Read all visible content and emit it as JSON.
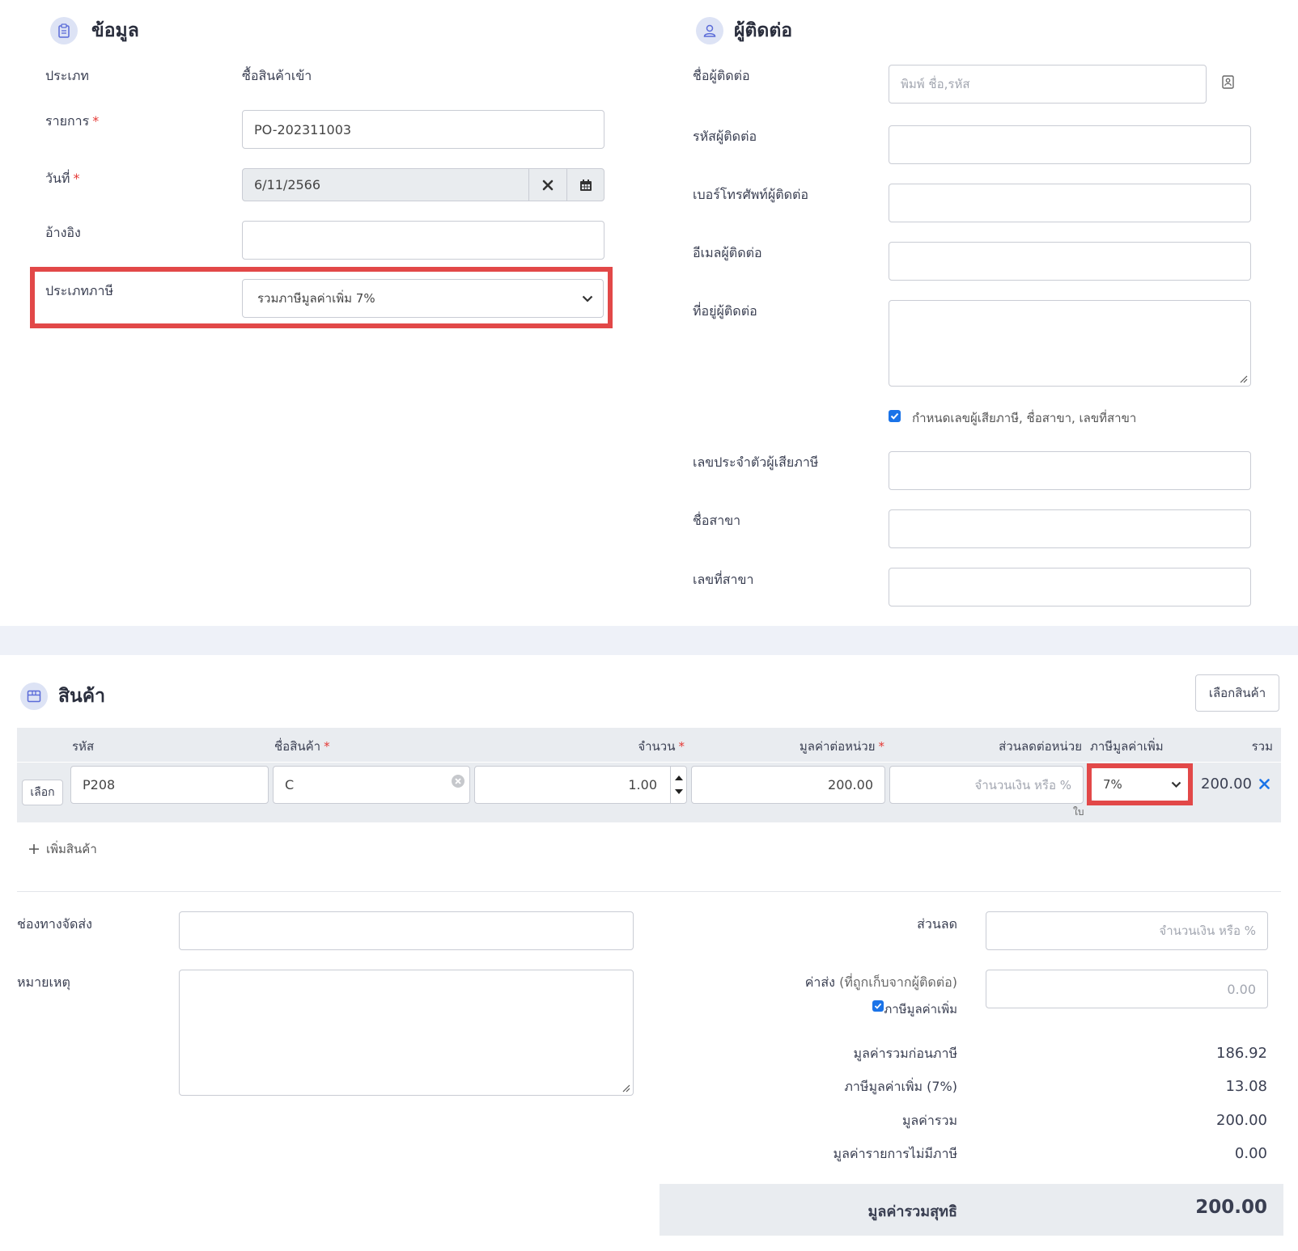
{
  "info": {
    "title": "ข้อมูล",
    "type_label": "ประเภท",
    "type_value": "ซื้อสินค้าเข้า",
    "doc_label": "รายการ",
    "doc_value": "PO-202311003",
    "date_label": "วันที่",
    "date_value": "6/11/2566",
    "ref_label": "อ้างอิง",
    "ref_value": "",
    "tax_type_label": "ประเภทภาษี",
    "tax_type_value": "รวมภาษีมูลค่าเพิ่ม 7%",
    "required_mark": "*"
  },
  "contact": {
    "title": "ผู้ติดต่อ",
    "name_label": "ชื่อผู้ติดต่อ",
    "name_placeholder": "พิมพ์ ชื่อ,รหัส",
    "code_label": "รหัสผู้ติดต่อ",
    "phone_label": "เบอร์โทรศัพท์ผู้ติดต่อ",
    "email_label": "อีเมลผู้ติดต่อ",
    "address_label": "ที่อยู่ผู้ติดต่อ",
    "taxid_checkbox_label": "กำหนดเลขผู้เสียภาษี, ชื่อสาขา, เลขที่สาขา",
    "taxid_label": "เลขประจำตัวผู้เสียภาษี",
    "branch_name_label": "ชื่อสาขา",
    "branch_no_label": "เลขที่สาขา"
  },
  "products": {
    "title": "สินค้า",
    "select_products_button": "เลือกสินค้า",
    "columns": {
      "code": "รหัส",
      "name": "ชื่อสินค้า",
      "qty": "จำนวน",
      "unit_price": "มูลค่าต่อหน่วย",
      "discount": "ส่วนลดต่อหน่วย",
      "vat": "ภาษีมูลค่าเพิ่ม",
      "total": "รวม"
    },
    "row": {
      "select_button": "เลือก",
      "code": "P208",
      "name": "C",
      "qty": "1.00",
      "unit_price": "200.00",
      "discount_placeholder": "จำนวนเงิน หรือ %",
      "unit": "ใบ",
      "vat": "7%",
      "total": "200.00"
    },
    "add_product": "เพิ่มสินค้า"
  },
  "footer": {
    "shipping_label": "ช่องทางจัดส่ง",
    "note_label": "หมายเหตุ",
    "discount_label": "ส่วนลด",
    "discount_placeholder": "จำนวนเงิน หรือ %",
    "shipping_fee_label": "ค่าส่ง",
    "shipping_fee_hint": "(ที่ถูกเก็บจากผู้ติดต่อ)",
    "shipping_fee_placeholder": "0.00",
    "shipping_vat_label": "ภาษีมูลค่าเพิ่ม",
    "pre_tax_label": "มูลค่ารวมก่อนภาษี",
    "pre_tax_value": "186.92",
    "vat_label": "ภาษีมูลค่าเพิ่ม (7%)",
    "vat_value": "13.08",
    "total_label": "มูลค่ารวม",
    "total_value": "200.00",
    "non_vat_label": "มูลค่ารายการไม่มีภาษี",
    "non_vat_value": "0.00",
    "net_label": "มูลค่ารวมสุทธิ",
    "net_value": "200.00"
  },
  "colors": {
    "highlight": "#e24848",
    "accent": "#1a73e8",
    "section_icon_bg": "#dde3f5",
    "table_header_bg": "#e9ecf0"
  }
}
